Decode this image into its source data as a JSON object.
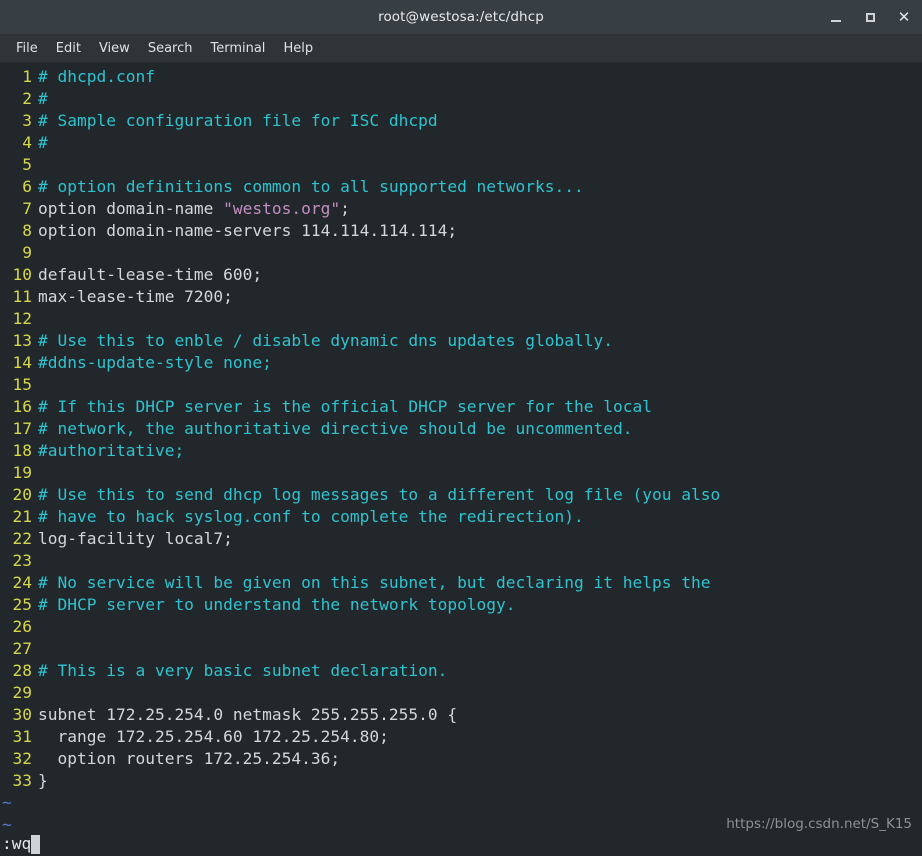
{
  "window": {
    "title": "root@westosa:/etc/dhcp",
    "controls": {
      "minimize_label": "_",
      "maximize_label": "□",
      "close_label": "✕"
    }
  },
  "menubar": {
    "items": [
      {
        "label": "File"
      },
      {
        "label": "Edit"
      },
      {
        "label": "View"
      },
      {
        "label": "Search"
      },
      {
        "label": "Terminal"
      },
      {
        "label": "Help"
      }
    ]
  },
  "editor": {
    "app": "vim",
    "filename": "dhcpd.conf",
    "colors": {
      "background": "#22272b",
      "line_number": "#d7d74a",
      "comment": "#2fc3cf",
      "string": "#c38fc0",
      "code": "#d3d7da",
      "tilde": "#5577c4"
    },
    "lines": [
      {
        "num": "1",
        "segments": [
          {
            "cls": "c-comment",
            "text": "# dhcpd.conf"
          }
        ]
      },
      {
        "num": "2",
        "segments": [
          {
            "cls": "c-comment",
            "text": "#"
          }
        ]
      },
      {
        "num": "3",
        "segments": [
          {
            "cls": "c-comment",
            "text": "# Sample configuration file for ISC dhcpd"
          }
        ]
      },
      {
        "num": "4",
        "segments": [
          {
            "cls": "c-comment",
            "text": "#"
          }
        ]
      },
      {
        "num": "5",
        "segments": [
          {
            "cls": "c-code",
            "text": ""
          }
        ]
      },
      {
        "num": "6",
        "segments": [
          {
            "cls": "c-comment",
            "text": "# option definitions common to all supported networks..."
          }
        ]
      },
      {
        "num": "7",
        "segments": [
          {
            "cls": "c-code",
            "text": "option domain-name "
          },
          {
            "cls": "c-string",
            "text": "\"westos.org\""
          },
          {
            "cls": "c-code",
            "text": ";"
          }
        ]
      },
      {
        "num": "8",
        "segments": [
          {
            "cls": "c-code",
            "text": "option domain-name-servers 114.114.114.114;"
          }
        ]
      },
      {
        "num": "9",
        "segments": [
          {
            "cls": "c-code",
            "text": ""
          }
        ]
      },
      {
        "num": "10",
        "segments": [
          {
            "cls": "c-code",
            "text": "default-lease-time 600;"
          }
        ]
      },
      {
        "num": "11",
        "segments": [
          {
            "cls": "c-code",
            "text": "max-lease-time 7200;"
          }
        ]
      },
      {
        "num": "12",
        "segments": [
          {
            "cls": "c-code",
            "text": ""
          }
        ]
      },
      {
        "num": "13",
        "segments": [
          {
            "cls": "c-comment",
            "text": "# Use this to enble / disable dynamic dns updates globally."
          }
        ]
      },
      {
        "num": "14",
        "segments": [
          {
            "cls": "c-comment",
            "text": "#ddns-update-style none;"
          }
        ]
      },
      {
        "num": "15",
        "segments": [
          {
            "cls": "c-code",
            "text": ""
          }
        ]
      },
      {
        "num": "16",
        "segments": [
          {
            "cls": "c-comment",
            "text": "# If this DHCP server is the official DHCP server for the local"
          }
        ]
      },
      {
        "num": "17",
        "segments": [
          {
            "cls": "c-comment",
            "text": "# network, the authoritative directive should be uncommented."
          }
        ]
      },
      {
        "num": "18",
        "segments": [
          {
            "cls": "c-comment",
            "text": "#authoritative;"
          }
        ]
      },
      {
        "num": "19",
        "segments": [
          {
            "cls": "c-code",
            "text": ""
          }
        ]
      },
      {
        "num": "20",
        "segments": [
          {
            "cls": "c-comment",
            "text": "# Use this to send dhcp log messages to a different log file (you also"
          }
        ]
      },
      {
        "num": "21",
        "segments": [
          {
            "cls": "c-comment",
            "text": "# have to hack syslog.conf to complete the redirection)."
          }
        ]
      },
      {
        "num": "22",
        "segments": [
          {
            "cls": "c-code",
            "text": "log-facility local7;"
          }
        ]
      },
      {
        "num": "23",
        "segments": [
          {
            "cls": "c-code",
            "text": ""
          }
        ]
      },
      {
        "num": "24",
        "segments": [
          {
            "cls": "c-comment",
            "text": "# No service will be given on this subnet, but declaring it helps the"
          }
        ]
      },
      {
        "num": "25",
        "segments": [
          {
            "cls": "c-comment",
            "text": "# DHCP server to understand the network topology."
          }
        ]
      },
      {
        "num": "26",
        "segments": [
          {
            "cls": "c-code",
            "text": ""
          }
        ]
      },
      {
        "num": "27",
        "segments": [
          {
            "cls": "c-code",
            "text": ""
          }
        ]
      },
      {
        "num": "28",
        "segments": [
          {
            "cls": "c-comment",
            "text": "# This is a very basic subnet declaration."
          }
        ]
      },
      {
        "num": "29",
        "segments": [
          {
            "cls": "c-code",
            "text": ""
          }
        ]
      },
      {
        "num": "30",
        "segments": [
          {
            "cls": "c-code",
            "text": "subnet 172.25.254.0 netmask 255.255.255.0 {"
          }
        ]
      },
      {
        "num": "31",
        "segments": [
          {
            "cls": "c-code",
            "text": "  range 172.25.254.60 172.25.254.80;"
          }
        ]
      },
      {
        "num": "32",
        "segments": [
          {
            "cls": "c-code",
            "text": "  option routers 172.25.254.36;"
          }
        ]
      },
      {
        "num": "33",
        "segments": [
          {
            "cls": "c-code",
            "text": "}"
          }
        ]
      }
    ],
    "filler_rows": [
      "~",
      "~"
    ],
    "status": {
      "command": ":wq"
    }
  },
  "watermark": {
    "text": "https://blog.csdn.net/S_K15"
  }
}
